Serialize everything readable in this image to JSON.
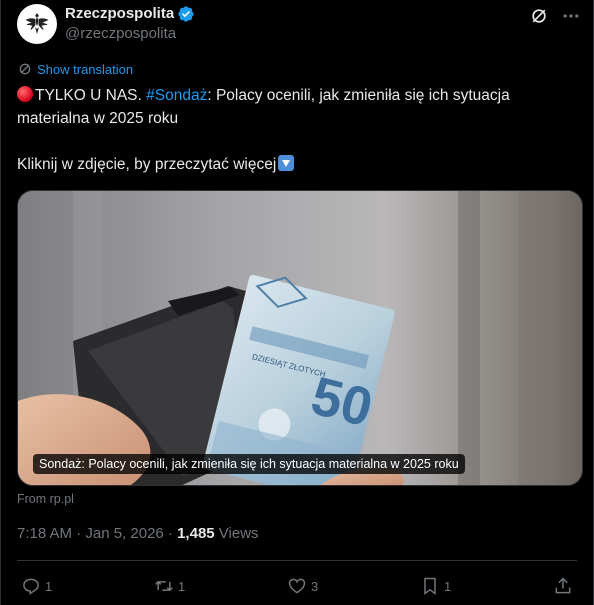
{
  "author": {
    "display_name": "Rzeczpospolita",
    "handle": "@rzeczpospolita",
    "avatar_icon": "eagle-logo-icon",
    "verified_icon": "verified-badge-icon"
  },
  "translation": {
    "label": "Show translation"
  },
  "post": {
    "prefix": "TYLKO U NAS. ",
    "hashtag": "#Sondaż",
    "headline": ": Polacy ocenili, jak zmieniła się ich sytuacja materialna w 2025 roku",
    "cta": "Kliknij w zdjęcie, by przeczytać więcej"
  },
  "media": {
    "caption": "Sondaż: Polacy ocenili, jak zmieniła się ich sytuacja materialna w 2025 roku",
    "source": "From rp.pl",
    "banknote_value": "50",
    "banknote_text": "DZIESIĄT ZŁOTYCH"
  },
  "meta": {
    "time_date": "7:18 AM · Jan 5, 2026 · ",
    "views_count": "1,485",
    "views_label": " Views"
  },
  "actions": {
    "replies": "1",
    "reposts": "1",
    "likes": "3",
    "bookmarks": "1"
  },
  "colors": {
    "background": "#000000",
    "text": "#e7e9ea",
    "muted": "#71767b",
    "link": "#1d9bf0",
    "verified": "#1d9bf0"
  }
}
